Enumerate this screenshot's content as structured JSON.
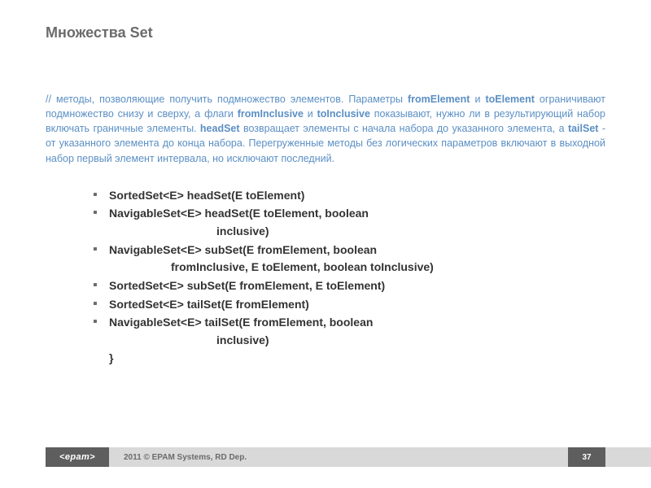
{
  "title": "Множества Set",
  "desc": {
    "t1": "// методы, позволяющие получить подмножество элементов. Параметры ",
    "b1": "fromElement",
    "t2": " и ",
    "b2": "toElement",
    "t3": " ограничивают подмножество снизу и сверху, а флаги ",
    "b3": "fromInclusive",
    "t4": " и ",
    "b4": "toInclusive",
    "t5": " показывают, нужно ли в результирующий набор включать граничные элементы. ",
    "b5": "headSet",
    "t6": " возвращает элементы с начала набора до указанного элемента, а ",
    "b6": "tailSet",
    "t7": " - от указанного элемента до конца набора. Перегруженные методы без логических параметров включают в выходной набор первый элемент интервала, но исключают последний."
  },
  "methods": {
    "m1": "SortedSet<E> headSet(E toElement)",
    "m2a": "NavigableSet<E> headSet(E toElement, boolean",
    "m2b": "inclusive)",
    "m3a": "NavigableSet<E> subSet(E fromElement, boolean",
    "m3b": "fromInclusive, E toElement, boolean toInclusive)",
    "m4": "SortedSet<E> subSet(E fromElement, E toElement)",
    "m5": "SortedSet<E> tailSet(E fromElement)",
    "m6a": "NavigableSet<E> tailSet(E fromElement, boolean",
    "m6b": "inclusive)"
  },
  "closebrace": "}",
  "footer": {
    "logo": "<epam>",
    "copyright": "2011 © EPAM Systems, RD Dep.",
    "page": "37"
  }
}
